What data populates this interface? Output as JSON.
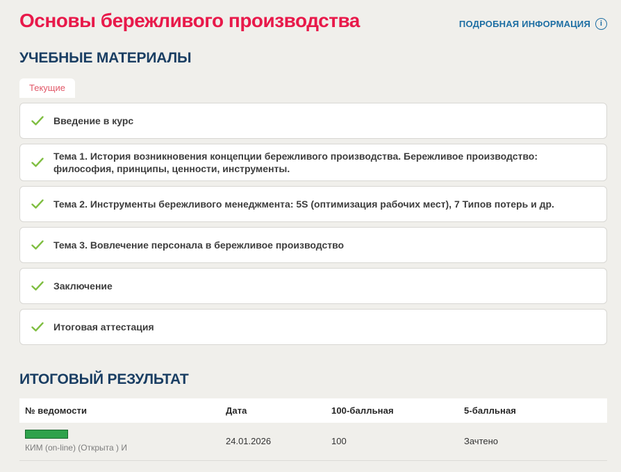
{
  "header": {
    "title": "Основы бережливого производства",
    "info_link_label": "ПОДРОБНАЯ ИНФОРМАЦИЯ",
    "info_icon_glyph": "i"
  },
  "materials": {
    "heading": "УЧЕБНЫЕ МАТЕРИАЛЫ",
    "active_tab": "Текущие",
    "items": [
      {
        "label": "Введение в курс",
        "status": "completed"
      },
      {
        "label": "Тема 1. История возникновения концепции бережливого производства. Бережливое производство: философия, принципы, ценности, инструменты.",
        "status": "completed"
      },
      {
        "label": "Тема 2. Инструменты бережливого менеджмента: 5S (оптимизация рабочих мест), 7 Типов потерь и др.",
        "status": "completed"
      },
      {
        "label": "Тема 3. Вовлечение персонала в бережливое производство",
        "status": "completed"
      },
      {
        "label": "Заключение",
        "status": "completed"
      },
      {
        "label": "Итоговая аттестация",
        "status": "completed"
      }
    ]
  },
  "results": {
    "heading": "ИТОГОВЫЙ РЕЗУЛЬТАТ",
    "columns": [
      "№ ведомости",
      "Дата",
      "100-балльная",
      "5-балльная"
    ],
    "rows": [
      {
        "sheet_number_redacted": true,
        "sheet_label": "КИМ (on-line) (Открыта ) И",
        "date": "24.01.2026",
        "score_100": "100",
        "score_5": "Зачтено"
      }
    ]
  },
  "colors": {
    "page_bg": "#f0efeb",
    "title": "#e8194a",
    "heading": "#1a3e63",
    "link_blue": "#1d6ea3",
    "tab_text": "#e25868",
    "check_green": "#7fbe41",
    "redaction_fill": "#2fa24c",
    "redaction_border": "#17682c"
  }
}
